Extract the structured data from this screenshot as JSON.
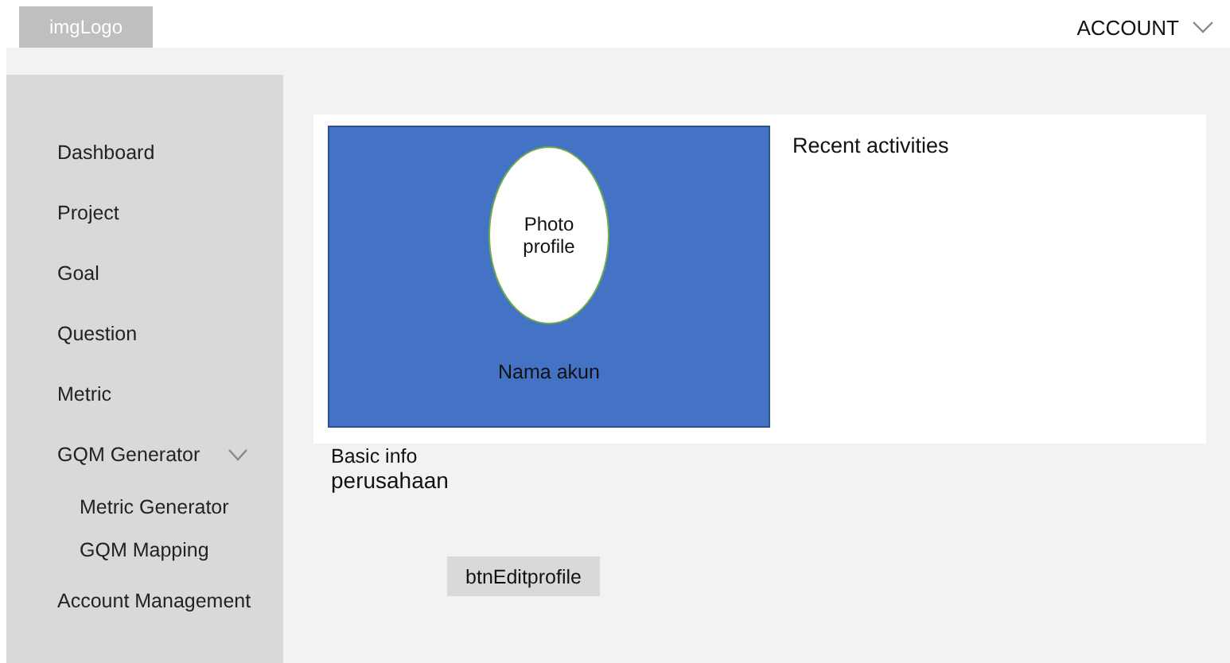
{
  "header": {
    "logo": "imgLogo",
    "account_menu": {
      "label": "ACCOUNT"
    }
  },
  "sidebar": {
    "items": [
      {
        "label": "Dashboard"
      },
      {
        "label": "Project"
      },
      {
        "label": "Goal"
      },
      {
        "label": "Question"
      },
      {
        "label": "Metric"
      },
      {
        "label": "GQM Generator",
        "expanded": true,
        "children": [
          {
            "label": "Metric Generator"
          },
          {
            "label": "GQM Mapping"
          }
        ]
      },
      {
        "label": "Account Management"
      }
    ]
  },
  "profile": {
    "photo_label": "Photo profile",
    "account_name": "Nama akun",
    "recent_title": "Recent activities",
    "basic_info_title": "Basic info",
    "basic_info_value": "perusahaan",
    "edit_button": "btnEditprofile"
  }
}
